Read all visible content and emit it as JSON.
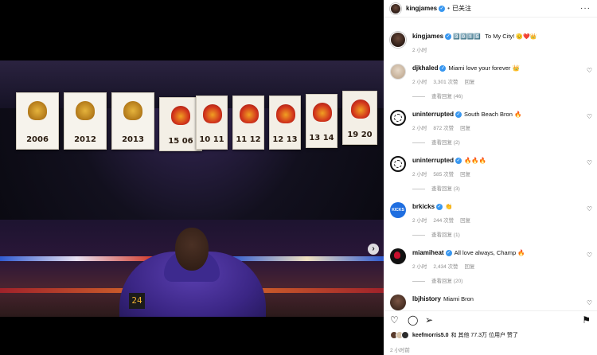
{
  "post": {
    "username": "kingjames",
    "follow_state": "已关注",
    "caption_emoji_left": "3️⃣0️⃣1️⃣5️⃣",
    "caption_text": "To My City!",
    "caption_emoji_right": "🫡❤️👑",
    "caption_time": "2 小时"
  },
  "media": {
    "banner_years": [
      "2006",
      "2012",
      "2013",
      "15 06",
      "10 11",
      "11 12",
      "12 13",
      "13 14",
      "19 20"
    ],
    "scoreboard": "24",
    "next_icon": "chevron-right-icon"
  },
  "comments": [
    {
      "user": "djkhaled",
      "verified": true,
      "text": "Miami love your forever 👑",
      "time": "2 小时",
      "likes": "3,301 次赞",
      "reply": "回复",
      "view_replies": "查看回复 (46)",
      "avatar": "dj"
    },
    {
      "user": "uninterrupted",
      "verified": true,
      "text": "South Beach Bron 🔥",
      "time": "2 小时",
      "likes": "872 次赞",
      "reply": "回复",
      "view_replies": "查看回复 (2)",
      "avatar": "un"
    },
    {
      "user": "uninterrupted",
      "verified": true,
      "text": "🔥🔥🔥",
      "time": "2 小时",
      "likes": "585 次赞",
      "reply": "回复",
      "view_replies": "查看回复 (3)",
      "avatar": "un"
    },
    {
      "user": "brkicks",
      "verified": true,
      "text": "👏",
      "time": "2 小时",
      "likes": "244 次赞",
      "reply": "回复",
      "view_replies": "查看回复 (1)",
      "avatar": "bk"
    },
    {
      "user": "miamiheat",
      "verified": true,
      "text": "All love always, Champ 🔥",
      "time": "2 小时",
      "likes": "2,434 次赞",
      "reply": "回复",
      "view_replies": "查看回复 (20)",
      "avatar": "mh"
    },
    {
      "user": "lbjhistory",
      "verified": false,
      "text": "Miami Bron",
      "time": "",
      "likes": "",
      "reply": "",
      "view_replies": "",
      "avatar": "lh"
    }
  ],
  "avatar_labels": {
    "bk": "KICKS"
  },
  "footer": {
    "liked_by_user": "keefmorris5.0",
    "liked_text": "和 其他 77.3万 位用户 赞了",
    "time": "2 小时前"
  },
  "colors": {
    "verified": "#3897f0",
    "muted": "#8e8e8e",
    "heat_red": "#c8102e"
  }
}
